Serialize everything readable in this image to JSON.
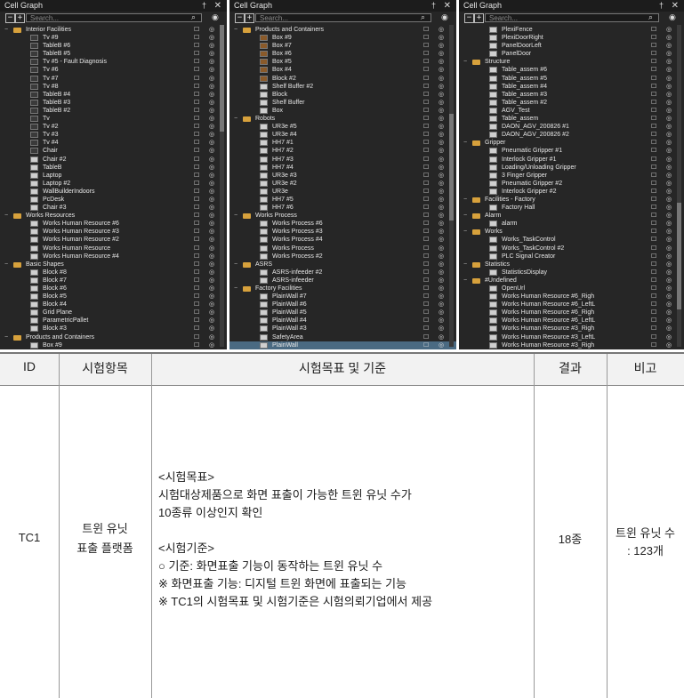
{
  "panels": [
    {
      "title": "Cell Graph",
      "search_placeholder": "Search...",
      "items": [
        {
          "label": "Interior Facilities",
          "kind": "folder",
          "level": 0
        },
        {
          "label": "Tv #9",
          "kind": "item",
          "level": 1
        },
        {
          "label": "TableB #6",
          "kind": "item",
          "level": 1
        },
        {
          "label": "TableB #5",
          "kind": "item",
          "level": 1
        },
        {
          "label": "Tv #5 - Fault Diagnosis",
          "kind": "item",
          "level": 1
        },
        {
          "label": "Tv #6",
          "kind": "item",
          "level": 1
        },
        {
          "label": "Tv #7",
          "kind": "item",
          "level": 1
        },
        {
          "label": "Tv #8",
          "kind": "item",
          "level": 1
        },
        {
          "label": "TableB #4",
          "kind": "item",
          "level": 1
        },
        {
          "label": "TableB #3",
          "kind": "item",
          "level": 1
        },
        {
          "label": "TableB #2",
          "kind": "item",
          "level": 1
        },
        {
          "label": "Tv",
          "kind": "item",
          "level": 1
        },
        {
          "label": "Tv #2",
          "kind": "item",
          "level": 1
        },
        {
          "label": "Tv #3",
          "kind": "item",
          "level": 1
        },
        {
          "label": "Tv #4",
          "kind": "item",
          "level": 1
        },
        {
          "label": "Chair",
          "kind": "item",
          "level": 1
        },
        {
          "label": "Chair #2",
          "kind": "item",
          "level": 1
        },
        {
          "label": "TableB",
          "kind": "item",
          "level": 1
        },
        {
          "label": "Laptop",
          "kind": "item",
          "level": 1
        },
        {
          "label": "Laptop #2",
          "kind": "item",
          "level": 1
        },
        {
          "label": "WallBuilderIndoors",
          "kind": "item",
          "level": 1
        },
        {
          "label": "PcDesk",
          "kind": "item",
          "level": 1
        },
        {
          "label": "Chair #3",
          "kind": "item",
          "level": 1
        },
        {
          "label": "Works Resources",
          "kind": "folder",
          "level": 0
        },
        {
          "label": "Works Human Resource #6",
          "kind": "item",
          "level": 1
        },
        {
          "label": "Works Human Resource #3",
          "kind": "item",
          "level": 1
        },
        {
          "label": "Works Human Resource #2",
          "kind": "item",
          "level": 1
        },
        {
          "label": "Works Human Resource",
          "kind": "item",
          "level": 1
        },
        {
          "label": "Works Human Resource #4",
          "kind": "item",
          "level": 1
        },
        {
          "label": "Basic Shapes",
          "kind": "folder",
          "level": 0
        },
        {
          "label": "Block #8",
          "kind": "item",
          "level": 1
        },
        {
          "label": "Block #7",
          "kind": "item",
          "level": 1
        },
        {
          "label": "Block #6",
          "kind": "item",
          "level": 1
        },
        {
          "label": "Block #5",
          "kind": "item",
          "level": 1
        },
        {
          "label": "Block #4",
          "kind": "item",
          "level": 1
        },
        {
          "label": "Grid Plane",
          "kind": "item",
          "level": 1
        },
        {
          "label": "ParametricPallet",
          "kind": "item",
          "level": 1
        },
        {
          "label": "Block #3",
          "kind": "item",
          "level": 1
        },
        {
          "label": "Products and Containers",
          "kind": "folder",
          "level": 0
        },
        {
          "label": "Box #9",
          "kind": "item",
          "level": 1
        }
      ]
    },
    {
      "title": "Cell Graph",
      "search_placeholder": "Search...",
      "items": [
        {
          "label": "Products and Containers",
          "kind": "folder",
          "level": 0
        },
        {
          "label": "Box #9",
          "kind": "item",
          "level": 1
        },
        {
          "label": "Box #7",
          "kind": "item",
          "level": 1
        },
        {
          "label": "Box #6",
          "kind": "item",
          "level": 1
        },
        {
          "label": "Box #5",
          "kind": "item",
          "level": 1
        },
        {
          "label": "Box #4",
          "kind": "item",
          "level": 1
        },
        {
          "label": "Block #2",
          "kind": "item",
          "level": 1
        },
        {
          "label": "Shelf Buffer #2",
          "kind": "item",
          "level": 1
        },
        {
          "label": "Block",
          "kind": "item",
          "level": 1
        },
        {
          "label": "Shelf Buffer",
          "kind": "item",
          "level": 1
        },
        {
          "label": "Box",
          "kind": "item",
          "level": 1
        },
        {
          "label": "Robots",
          "kind": "folder",
          "level": 0
        },
        {
          "label": "UR3e #5",
          "kind": "item",
          "level": 1
        },
        {
          "label": "UR3e #4",
          "kind": "item",
          "level": 1
        },
        {
          "label": "HH7 #1",
          "kind": "item",
          "level": 1
        },
        {
          "label": "HH7 #2",
          "kind": "item",
          "level": 1
        },
        {
          "label": "HH7 #3",
          "kind": "item",
          "level": 1
        },
        {
          "label": "HH7 #4",
          "kind": "item",
          "level": 1
        },
        {
          "label": "UR3e #3",
          "kind": "item",
          "level": 1
        },
        {
          "label": "UR3e #2",
          "kind": "item",
          "level": 1
        },
        {
          "label": "UR3e",
          "kind": "item",
          "level": 1
        },
        {
          "label": "HH7 #5",
          "kind": "item",
          "level": 1
        },
        {
          "label": "HH7 #6",
          "kind": "item",
          "level": 1
        },
        {
          "label": "Works Process",
          "kind": "folder",
          "level": 0
        },
        {
          "label": "Works Process #6",
          "kind": "item",
          "level": 1
        },
        {
          "label": "Works Process #3",
          "kind": "item",
          "level": 1
        },
        {
          "label": "Works Process #4",
          "kind": "item",
          "level": 1
        },
        {
          "label": "Works Process",
          "kind": "item",
          "level": 1
        },
        {
          "label": "Works Process #2",
          "kind": "item",
          "level": 1
        },
        {
          "label": "ASRS",
          "kind": "folder",
          "level": 0
        },
        {
          "label": "ASRS-infeeder #2",
          "kind": "item",
          "level": 1
        },
        {
          "label": "ASRS-infeeder",
          "kind": "item",
          "level": 1
        },
        {
          "label": "Factory Facilities",
          "kind": "folder",
          "level": 0
        },
        {
          "label": "PlainWall #7",
          "kind": "item",
          "level": 1
        },
        {
          "label": "PlainWall #6",
          "kind": "item",
          "level": 1
        },
        {
          "label": "PlainWall #5",
          "kind": "item",
          "level": 1
        },
        {
          "label": "PlainWall #4",
          "kind": "item",
          "level": 1
        },
        {
          "label": "PlainWall #3",
          "kind": "item",
          "level": 1
        },
        {
          "label": "SafetyArea",
          "kind": "item",
          "level": 1
        },
        {
          "label": "PlainWall",
          "kind": "item",
          "level": 1,
          "selected": true
        }
      ]
    },
    {
      "title": "Cell Graph",
      "search_placeholder": "Search...",
      "items": [
        {
          "label": "PlexiFence",
          "kind": "item",
          "level": 1
        },
        {
          "label": "PlexiDoorRight",
          "kind": "item",
          "level": 1
        },
        {
          "label": "PanelDoorLeft",
          "kind": "item",
          "level": 1
        },
        {
          "label": "PanelDoor",
          "kind": "item",
          "level": 1
        },
        {
          "label": "Structure",
          "kind": "folder",
          "level": 0
        },
        {
          "label": "Table_assem #6",
          "kind": "item",
          "level": 1
        },
        {
          "label": "Table_assem #5",
          "kind": "item",
          "level": 1
        },
        {
          "label": "Table_assem #4",
          "kind": "item",
          "level": 1
        },
        {
          "label": "Table_assem #3",
          "kind": "item",
          "level": 1
        },
        {
          "label": "Table_assem #2",
          "kind": "item",
          "level": 1
        },
        {
          "label": "AGV_Test",
          "kind": "item",
          "level": 1
        },
        {
          "label": "Table_assem",
          "kind": "item",
          "level": 1
        },
        {
          "label": "DAON_AGV_200826 #1",
          "kind": "item",
          "level": 1
        },
        {
          "label": "DAON_AGV_200826 #2",
          "kind": "item",
          "level": 1
        },
        {
          "label": "Gripper",
          "kind": "folder",
          "level": 0
        },
        {
          "label": "Pneumatic Gripper #1",
          "kind": "item",
          "level": 1
        },
        {
          "label": "Interlock Gripper #1",
          "kind": "item",
          "level": 1
        },
        {
          "label": "Loading/Unloading Gripper",
          "kind": "item",
          "level": 1
        },
        {
          "label": "3 Finger Gripper",
          "kind": "item",
          "level": 1
        },
        {
          "label": "Pneumatic Gripper #2",
          "kind": "item",
          "level": 1
        },
        {
          "label": "Interlock Gripper #2",
          "kind": "item",
          "level": 1
        },
        {
          "label": "Facilities - Factory",
          "kind": "folder",
          "level": 0
        },
        {
          "label": "Factory Hall",
          "kind": "item",
          "level": 1
        },
        {
          "label": "Alarm",
          "kind": "folder",
          "level": 0
        },
        {
          "label": "alarm",
          "kind": "item",
          "level": 1
        },
        {
          "label": "Works",
          "kind": "folder",
          "level": 0
        },
        {
          "label": "Works_TaskControl",
          "kind": "item",
          "level": 1
        },
        {
          "label": "Works_TaskControl #2",
          "kind": "item",
          "level": 1
        },
        {
          "label": "PLC Signal Creator",
          "kind": "item",
          "level": 1
        },
        {
          "label": "Statistics",
          "kind": "folder",
          "level": 0
        },
        {
          "label": "StatisticsDisplay",
          "kind": "item",
          "level": 1
        },
        {
          "label": "#Undefined",
          "kind": "folder",
          "level": 0
        },
        {
          "label": "OpenUrl",
          "kind": "item",
          "level": 1
        },
        {
          "label": "Works Human Resource #6_Righ",
          "kind": "item",
          "level": 1
        },
        {
          "label": "Works Human Resource #6_LeftL",
          "kind": "item",
          "level": 1
        },
        {
          "label": "Works Human Resource #6_Righ",
          "kind": "item",
          "level": 1
        },
        {
          "label": "Works Human Resource #6_LeftL",
          "kind": "item",
          "level": 1
        },
        {
          "label": "Works Human Resource #3_Righ",
          "kind": "item",
          "level": 1
        },
        {
          "label": "Works Human Resource #3_LeftL",
          "kind": "item",
          "level": 1
        },
        {
          "label": "Works Human Resource #3_Righ",
          "kind": "item",
          "level": 1
        }
      ]
    }
  ],
  "table": {
    "headers": [
      "ID",
      "시험항목",
      "시험목표 및 기준",
      "결과",
      "비고"
    ],
    "row": {
      "id": "TC1",
      "item_line1": "트윈 유닛",
      "item_line2": "표출 플랫폼",
      "goal_lines": [
        "<시험목표>",
        "시험대상제품으로 화면 표출이 가능한 트윈 유닛 수가",
        "10종류 이상인지 확인",
        "",
        "<시험기준>",
        " ○ 기준: 화면표출 기능이 동작하는 트윈 유닛 수",
        "※ 화면표출 기능: 디지털 트윈 화면에 표출되는 기능",
        "※ TC1의 시험목표 및 시험기준은 시험의뢰기업에서 제공"
      ],
      "result": "18종",
      "remark_line1": "트윈 유닛 수",
      "remark_line2": ": 123개"
    }
  }
}
